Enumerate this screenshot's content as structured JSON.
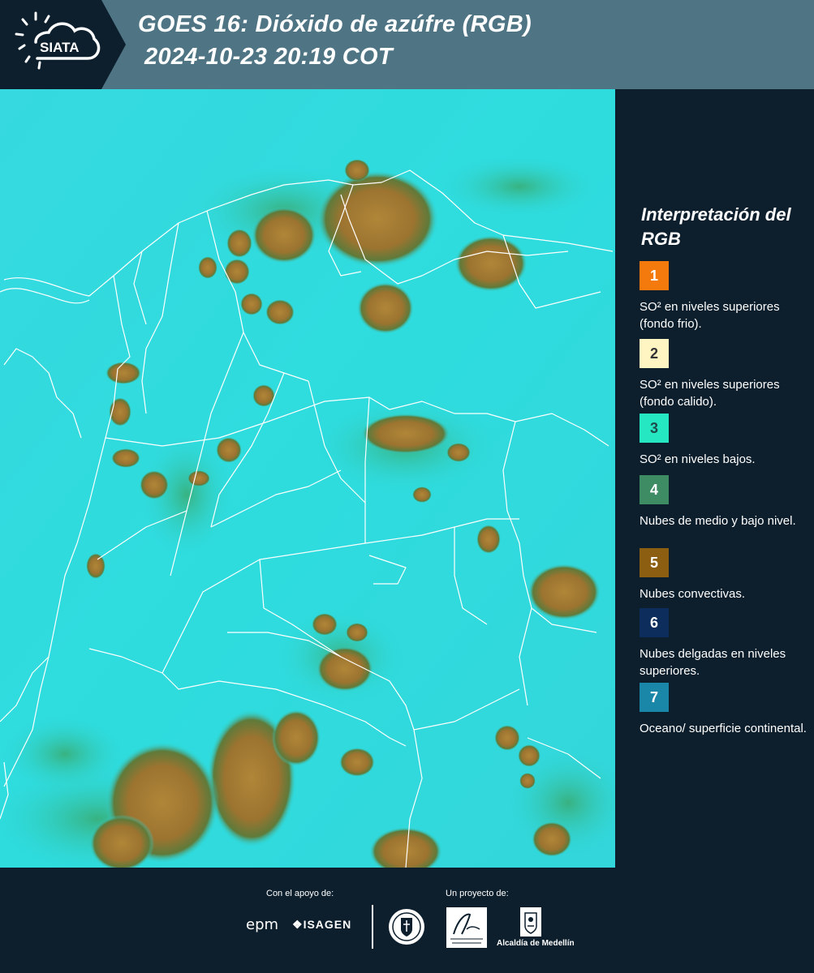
{
  "header": {
    "logo_text": "SIATA",
    "title_line1": "GOES 16: Dióxido de azúfre (RGB)",
    "title_line2": "2024-10-23 20:19 COT"
  },
  "map": {
    "background_color": "#2fdcde",
    "convective_color": "#a77a33",
    "border_color": "#ffffff"
  },
  "legend": {
    "title": "Interpretación del RGB",
    "items": [
      {
        "number": "1",
        "color": "#f47a0e",
        "text": "SO² en niveles superiores (fondo frio)."
      },
      {
        "number": "2",
        "color": "#fff5c2",
        "text": "SO² en niveles superiores (fondo calido)."
      },
      {
        "number": "3",
        "color": "#25e8c3",
        "text": "SO² en niveles bajos."
      },
      {
        "number": "4",
        "color": "#3e8c64",
        "text": "Nubes de medio y bajo nivel."
      },
      {
        "number": "5",
        "color": "#8b5e12",
        "text": "Nubes convectivas."
      },
      {
        "number": "6",
        "color": "#0d2d5c",
        "text": "Nubes delgadas en niveles superiores."
      },
      {
        "number": "7",
        "color": "#1a86a8",
        "text": "Oceano/ superficie continental."
      }
    ]
  },
  "footer": {
    "support_label": "Con el apoyo de:",
    "project_label": "Un proyecto de:",
    "sponsors": [
      "epm",
      "ISAGEN"
    ],
    "partners": [
      "Área Metropolitana Valle de Aburrá",
      "Alcaldía de Medellín"
    ],
    "alcaldia_text": "Alcaldía de Medellín"
  }
}
